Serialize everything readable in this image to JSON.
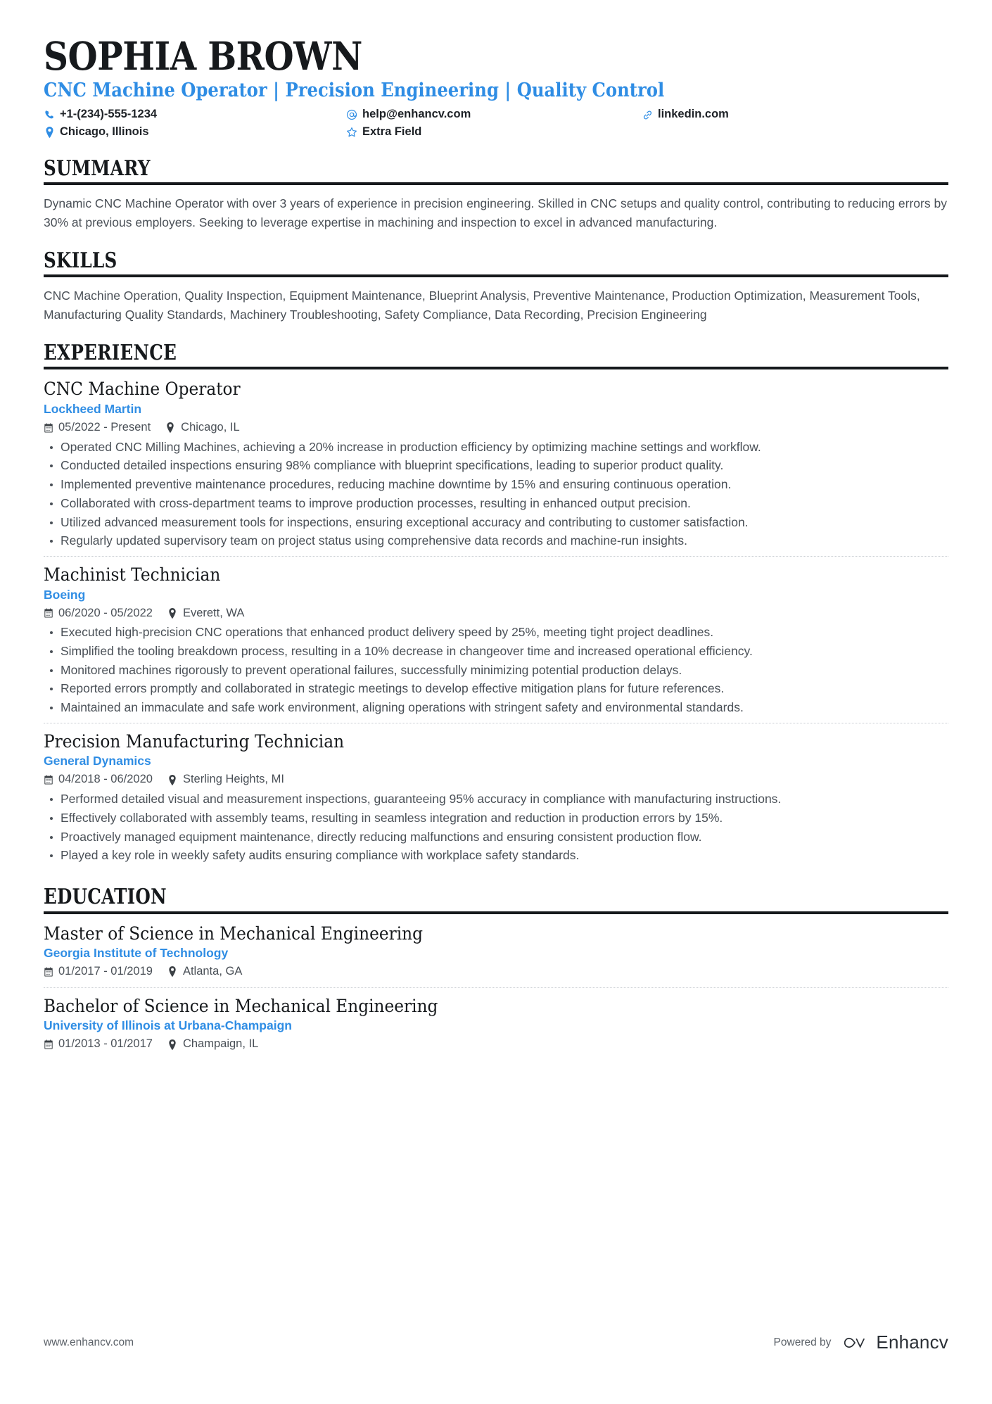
{
  "header": {
    "name": "SOPHIA BROWN",
    "headline": "CNC Machine Operator | Precision Engineering | Quality Control",
    "contacts": [
      {
        "icon": "phone-icon",
        "text": "+1-(234)-555-1234"
      },
      {
        "icon": "email-icon",
        "text": "help@enhancv.com"
      },
      {
        "icon": "link-icon",
        "text": "linkedin.com"
      },
      {
        "icon": "location-pin-icon",
        "text": "Chicago, Illinois"
      },
      {
        "icon": "star-icon",
        "text": "Extra Field"
      }
    ]
  },
  "summary": {
    "title": "SUMMARY",
    "text": "Dynamic CNC Machine Operator with over 3 years of experience in precision engineering. Skilled in CNC setups and quality control, contributing to reducing errors by 30% at previous employers. Seeking to leverage expertise in machining and inspection to excel in advanced manufacturing."
  },
  "skills": {
    "title": "SKILLS",
    "text": "CNC Machine Operation, Quality Inspection, Equipment Maintenance, Blueprint Analysis, Preventive Maintenance, Production Optimization, Measurement Tools, Manufacturing Quality Standards, Machinery Troubleshooting, Safety Compliance, Data Recording, Precision Engineering"
  },
  "experience": {
    "title": "EXPERIENCE",
    "entries": [
      {
        "title": "CNC Machine Operator",
        "org": "Lockheed Martin",
        "dates": "05/2022 - Present",
        "location": "Chicago, IL",
        "bullets": [
          "Operated CNC Milling Machines, achieving a 20% increase in production efficiency by optimizing machine settings and workflow.",
          "Conducted detailed inspections ensuring 98% compliance with blueprint specifications, leading to superior product quality.",
          "Implemented preventive maintenance procedures, reducing machine downtime by 15% and ensuring continuous operation.",
          "Collaborated with cross-department teams to improve production processes, resulting in enhanced output precision.",
          "Utilized advanced measurement tools for inspections, ensuring exceptional accuracy and contributing to customer satisfaction.",
          "Regularly updated supervisory team on project status using comprehensive data records and machine-run insights."
        ]
      },
      {
        "title": "Machinist Technician",
        "org": "Boeing",
        "dates": "06/2020 - 05/2022",
        "location": "Everett, WA",
        "bullets": [
          "Executed high-precision CNC operations that enhanced product delivery speed by 25%, meeting tight project deadlines.",
          "Simplified the tooling breakdown process, resulting in a 10% decrease in changeover time and increased operational efficiency.",
          "Monitored machines rigorously to prevent operational failures, successfully minimizing potential production delays.",
          "Reported errors promptly and collaborated in strategic meetings to develop effective mitigation plans for future references.",
          "Maintained an immaculate and safe work environment, aligning operations with stringent safety and environmental standards."
        ]
      },
      {
        "title": "Precision Manufacturing Technician",
        "org": "General Dynamics",
        "dates": "04/2018 - 06/2020",
        "location": "Sterling Heights, MI",
        "bullets": [
          "Performed detailed visual and measurement inspections, guaranteeing 95% accuracy in compliance with manufacturing instructions.",
          "Effectively collaborated with assembly teams, resulting in seamless integration and reduction in production errors by 15%.",
          "Proactively managed equipment maintenance, directly reducing malfunctions and ensuring consistent production flow.",
          "Played a key role in weekly safety audits ensuring compliance with workplace safety standards."
        ]
      }
    ]
  },
  "education": {
    "title": "EDUCATION",
    "entries": [
      {
        "title": "Master of Science in Mechanical Engineering",
        "org": "Georgia Institute of Technology",
        "dates": "01/2017 - 01/2019",
        "location": "Atlanta, GA"
      },
      {
        "title": "Bachelor of Science in Mechanical Engineering",
        "org": "University of Illinois at Urbana-Champaign",
        "dates": "01/2013 - 01/2017",
        "location": "Champaign, IL"
      }
    ]
  },
  "footer": {
    "url": "www.enhancv.com",
    "powered_by": "Powered by",
    "brand": "Enhancv"
  },
  "colors": {
    "accent": "#2f8de4",
    "heading": "#16191c",
    "body": "#4a5057"
  }
}
